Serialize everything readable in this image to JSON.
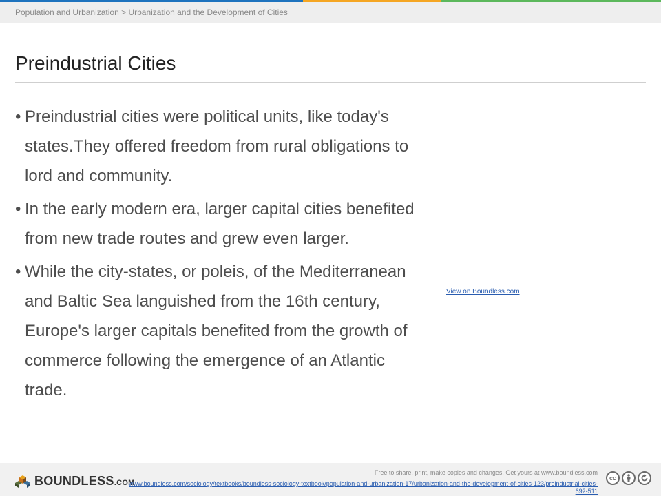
{
  "header": {
    "breadcrumb": "Population and Urbanization > Urbanization  and the Development of Cities",
    "stripe_colors": [
      "#1e73be",
      "#f5a623",
      "#5cb85c"
    ]
  },
  "slide": {
    "title": "Preindustrial Cities",
    "bullets": [
      "Preindustrial cities were political units, like today's states.They offered freedom from rural obligations to lord and community.",
      "In the early modern era, larger capital cities benefited from new trade routes and grew even larger.",
      "While the city-states, or poleis, of the Mediterranean and Baltic Sea languished from the 16th century, Europe's larger capitals benefited from the growth of commerce following the emergence of an Atlantic trade."
    ],
    "view_link": "View on Boundless.com"
  },
  "footer": {
    "logo_text": "BOUNDLESS",
    "logo_suffix": ".COM",
    "note": "Free to share, print, make copies and changes. Get yours at www.boundless.com",
    "url": "www.boundless.com/sociology/textbooks/boundless-sociology-textbook/population-and-urbanization-17/urbanization-and-the-development-of-cities-123/preindustrial-cities-692-511",
    "license_icons": [
      "cc-icon",
      "by-icon",
      "sa-icon"
    ]
  }
}
